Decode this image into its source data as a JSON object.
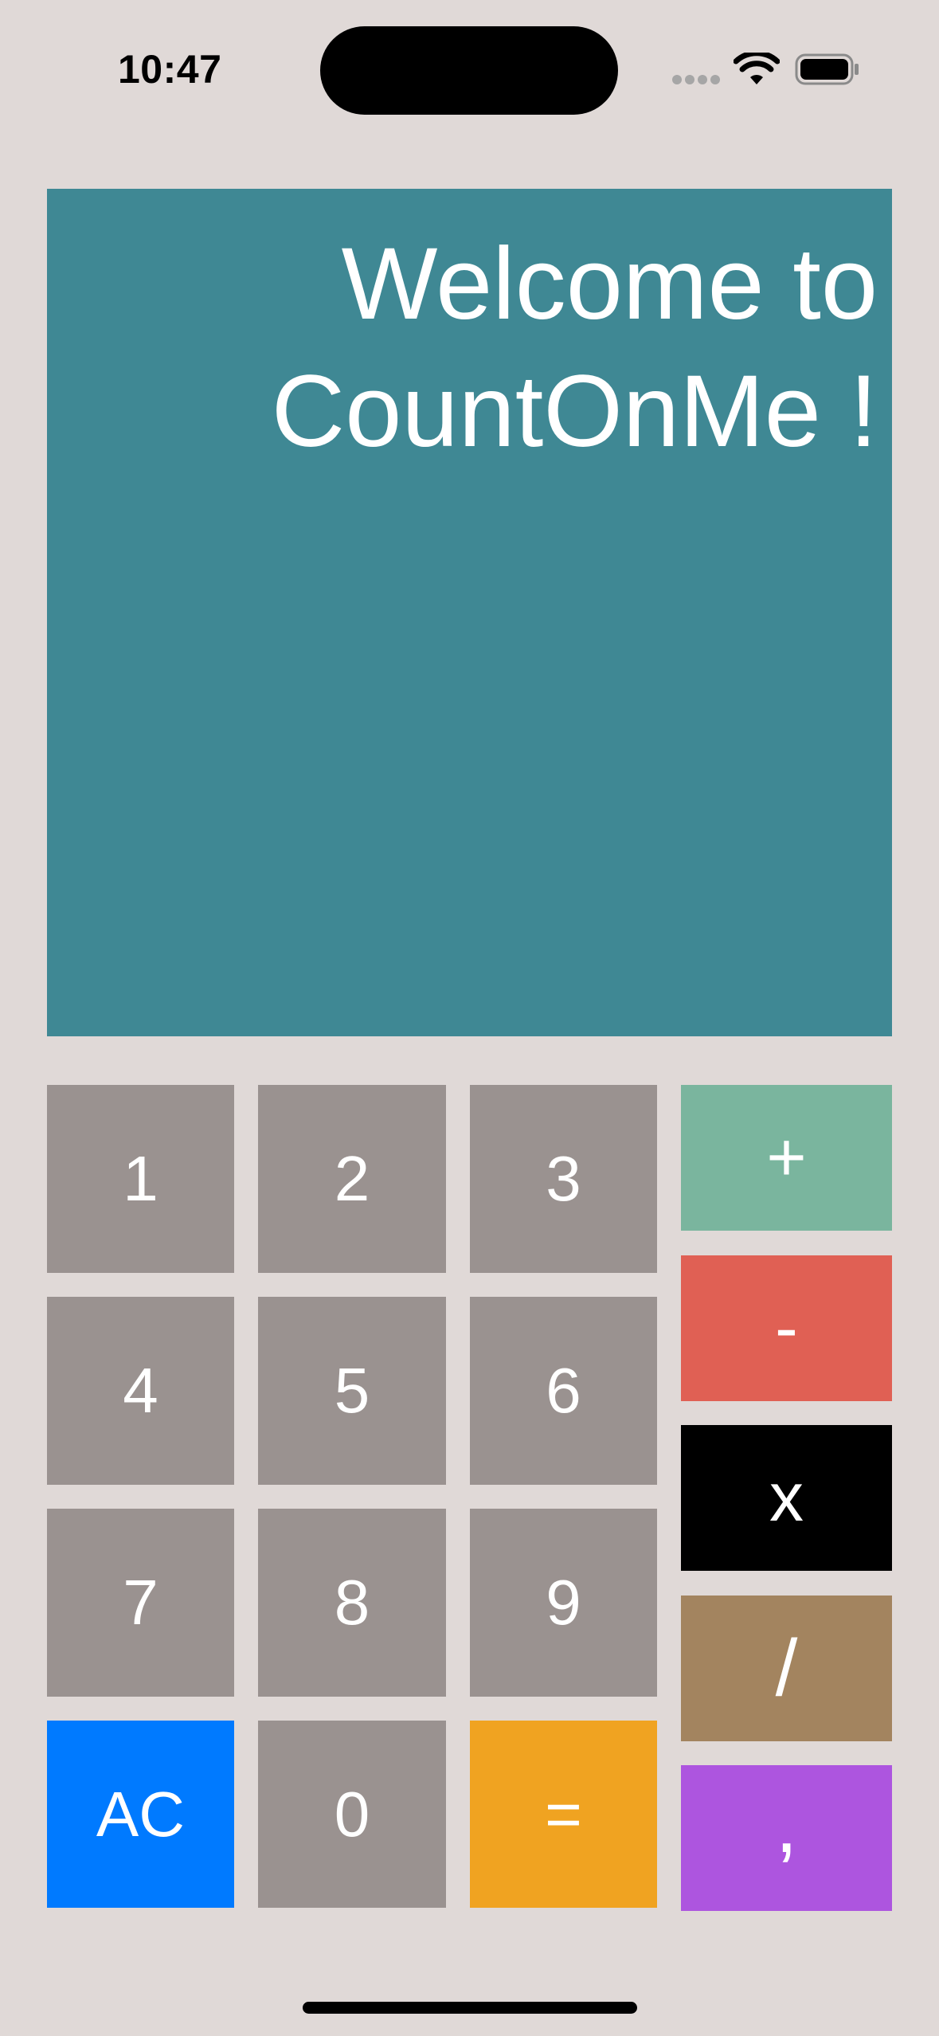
{
  "status_bar": {
    "time": "10:47",
    "icons": [
      "cellular-signal-icon",
      "wifi-icon",
      "battery-icon"
    ]
  },
  "display": {
    "text": "Welcome to\nCountOnMe !",
    "background": "#3f8894"
  },
  "keypad": {
    "digits": {
      "one": "1",
      "two": "2",
      "three": "3",
      "four": "4",
      "five": "5",
      "six": "6",
      "seven": "7",
      "eight": "8",
      "nine": "9",
      "zero": "0"
    },
    "clear": "AC",
    "equals": "=",
    "operators": {
      "plus": "+",
      "minus": "-",
      "times": "x",
      "divide": "/",
      "comma": ","
    }
  },
  "colors": {
    "background": "#e0d9d7",
    "digit_key": "#9a9290",
    "clear_key": "#007aff",
    "equals_key": "#f0a321",
    "plus_key": "#7ab59e",
    "minus_key": "#e06054",
    "times_key": "#000000",
    "divide_key": "#a3845f",
    "comma_key": "#ad55df"
  }
}
